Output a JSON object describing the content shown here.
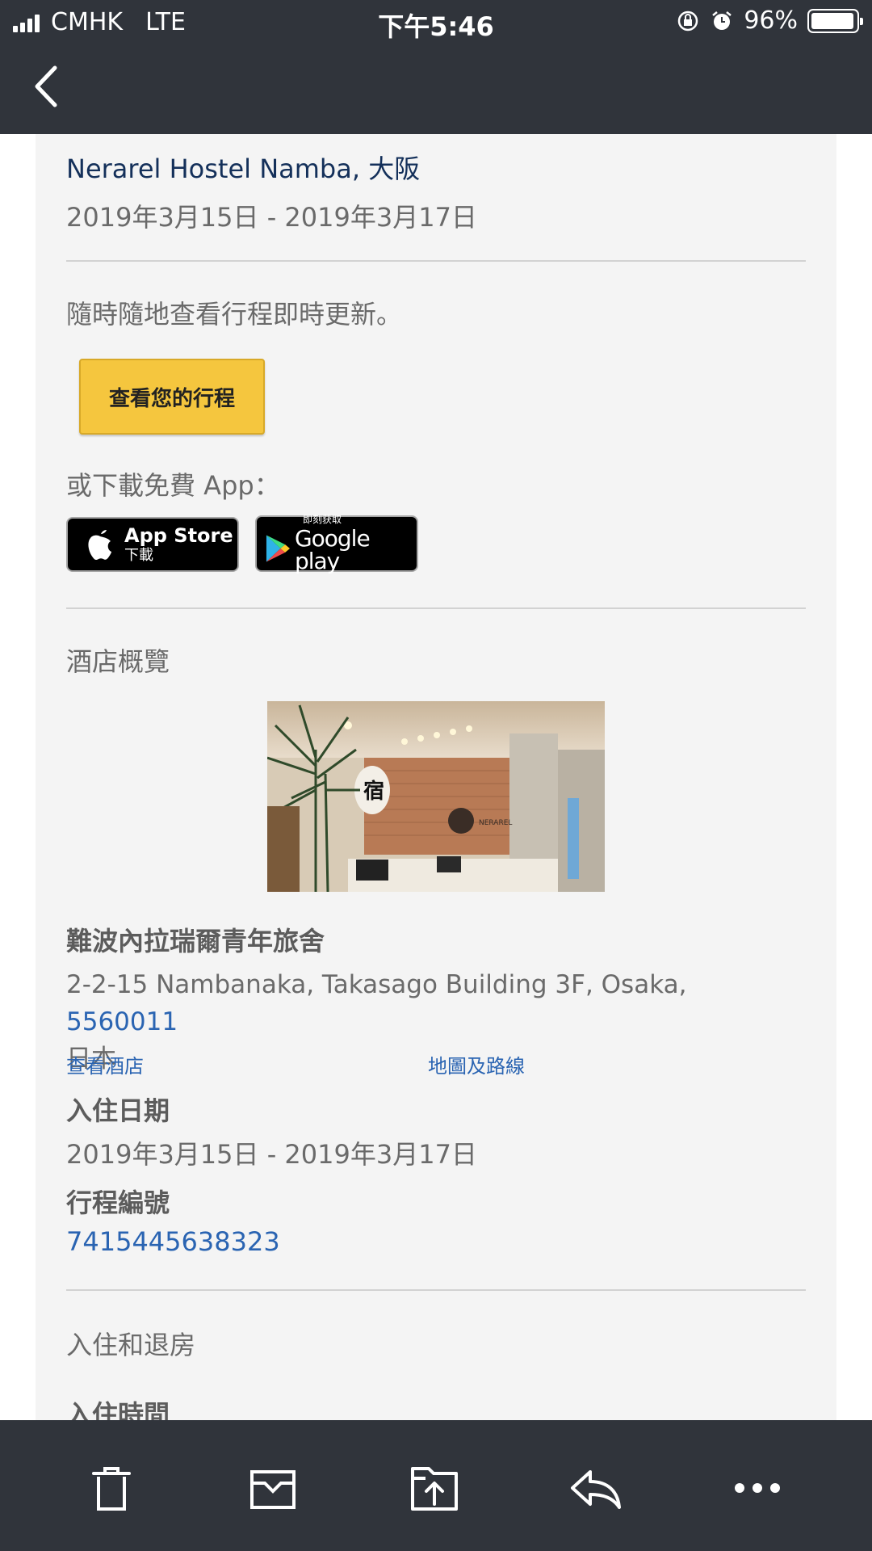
{
  "status_bar": {
    "carrier": "CMHK",
    "network": "LTE",
    "time": "下午5:46",
    "battery": "96%"
  },
  "email": {
    "hotel_title": "Nerarel Hostel Namba, 大阪",
    "date_range_top": "2019年3月15日 - 2019年3月17日",
    "update_text": "隨時隨地查看行程即時更新。",
    "cta_label": "查看您的行程",
    "download_text": "或下載免費 App：",
    "app_store": {
      "line1": "App Store",
      "line2": "下載"
    },
    "google_play": {
      "line1": "即刻获取",
      "line2": "Google play"
    },
    "overview_title": "酒店概覽",
    "photo_sign_char": "宿",
    "photo_sign_text": "NERAREL",
    "hotel_name": "難波內拉瑞爾青年旅舍",
    "address_line1": "2-2-15 Nambanaka, Takasago Building 3F, Osaka,",
    "address_zip": "5560011",
    "address_country": "日本",
    "link_view_hotel": "查看酒店",
    "link_map": "地圖及路線",
    "checkin_label": "入住日期",
    "checkin_date": "2019年3月15日 - 2019年3月17日",
    "itinerary_label": "行程編號",
    "itinerary_number": "7415445638323",
    "checkinout_title": "入住和退房",
    "checkin_time_label": "入住時間"
  },
  "toolbar": {
    "icons": [
      "trash-icon",
      "archive-icon",
      "move-folder-icon",
      "reply-icon",
      "more-icon"
    ]
  },
  "colors": {
    "bar": "#30343b",
    "card": "#f4f4f4",
    "cta": "#f5c63e",
    "link": "#2a64b2",
    "title": "#14305a"
  }
}
